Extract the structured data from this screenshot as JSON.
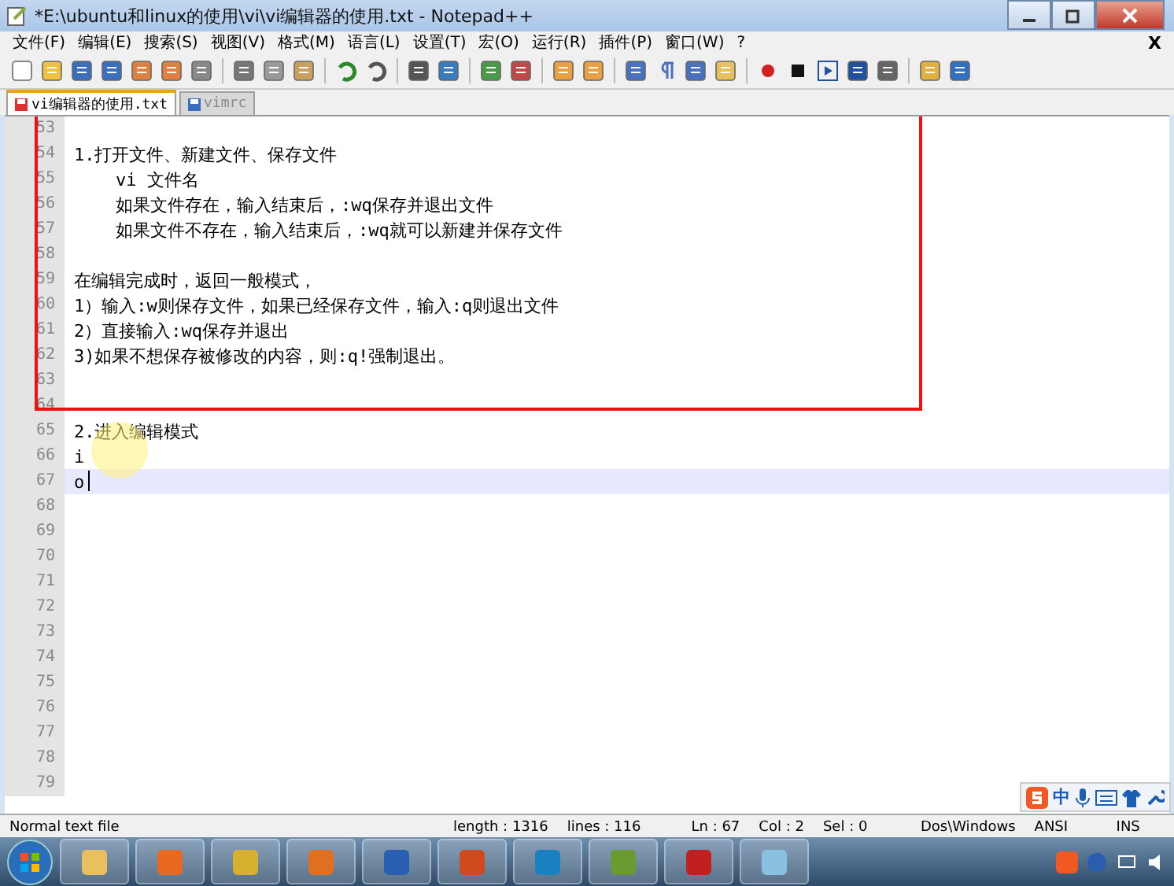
{
  "window": {
    "title": "*E:\\ubuntu和linux的使用\\vi\\vi编辑器的使用.txt - Notepad++"
  },
  "menu": [
    "文件(F)",
    "编辑(E)",
    "搜索(S)",
    "视图(V)",
    "格式(M)",
    "语言(L)",
    "设置(T)",
    "宏(O)",
    "运行(R)",
    "插件(P)",
    "窗口(W)",
    "?"
  ],
  "menu_close": "X",
  "tabs": [
    {
      "label": "vi编辑器的使用.txt",
      "selected": true,
      "modified": true
    },
    {
      "label": "vimrc",
      "selected": false,
      "modified": false
    }
  ],
  "editor": {
    "lines": [
      {
        "number": "53",
        "selected": false
      },
      {
        "number": "54",
        "text": "1.打开文件、新建文件、保存文件",
        "selected": false
      },
      {
        "number": "55",
        "text": "    vi 文件名",
        "selected": false
      },
      {
        "number": "56",
        "text": "    如果文件存在，输入结束后，:wq保存并退出文件",
        "selected": false
      },
      {
        "number": "57",
        "text": "    如果文件不存在，输入结束后，:wq就可以新建并保存文件",
        "selected": false
      },
      {
        "number": "58",
        "selected": false
      },
      {
        "number": "59",
        "text": "在编辑完成时，返回一般模式，",
        "selected": false
      },
      {
        "number": "60",
        "text": "1）输入:w则保存文件，如果已经保存文件，输入:q则退出文件",
        "selected": false
      },
      {
        "number": "61",
        "text": "2）直接输入:wq保存并退出",
        "selected": false
      },
      {
        "number": "62",
        "text": "3)如果不想保存被修改的内容，则:q!强制退出。",
        "selected": false
      },
      {
        "number": "63",
        "selected": false
      },
      {
        "number": "64",
        "selected": false
      },
      {
        "number": "65",
        "text": "2.进入编辑模式",
        "selected": false
      },
      {
        "number": "66",
        "text": "i",
        "selected": false
      },
      {
        "number": "67",
        "text": "o",
        "selected": true
      },
      {
        "number": "68",
        "selected": false
      },
      {
        "number": "69",
        "selected": false
      },
      {
        "number": "70",
        "selected": false
      },
      {
        "number": "71",
        "selected": false
      },
      {
        "number": "72",
        "selected": false
      },
      {
        "number": "73",
        "selected": false
      },
      {
        "number": "74",
        "selected": false
      },
      {
        "number": "75",
        "selected": false
      },
      {
        "number": "76",
        "selected": false
      },
      {
        "number": "77",
        "selected": false
      },
      {
        "number": "78",
        "selected": false
      },
      {
        "number": "79",
        "selected": false
      }
    ]
  },
  "ime": {
    "mode": "中"
  },
  "status_bar": {
    "file_type": "Normal text file",
    "length": "length : 1316",
    "lines": "lines : 116",
    "line": "Ln : 67",
    "column": "Col : 2",
    "selection": "Sel : 0",
    "eol": "Dos\\Windows",
    "encoding": "ANSI",
    "insert_mode": "INS"
  }
}
